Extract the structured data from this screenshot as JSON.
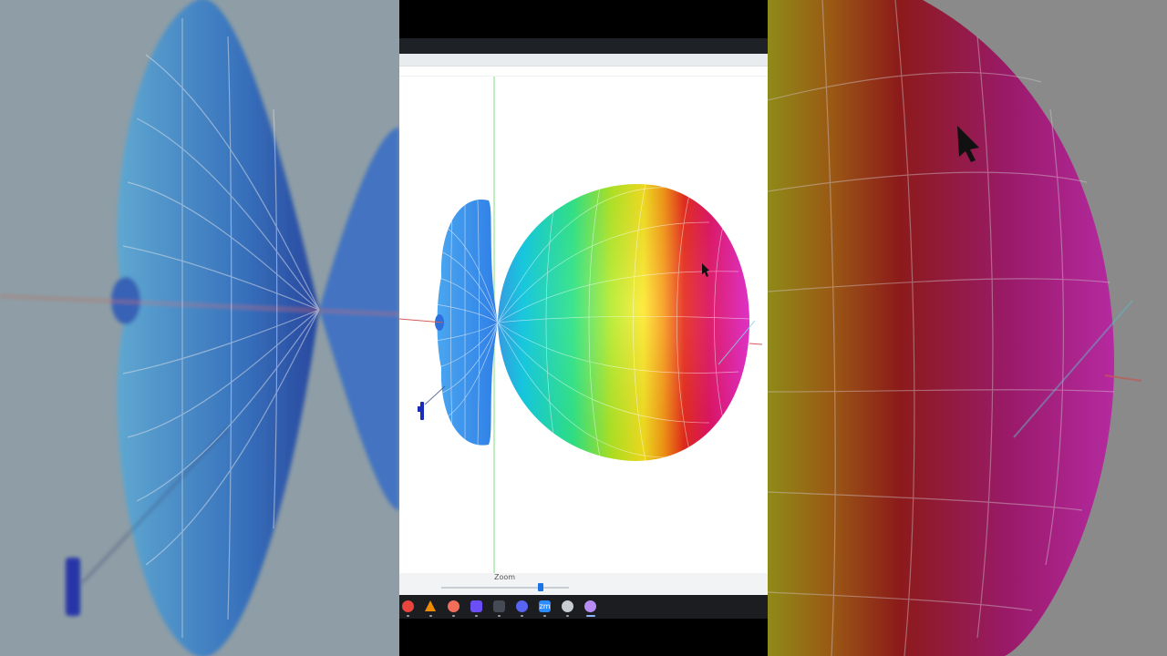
{
  "viewer": {
    "zoom_label": "Zoom",
    "zoom_level": 0.78
  },
  "taskbar": {
    "items": [
      {
        "icon": "chrome-icon",
        "color": "#e8453c"
      },
      {
        "icon": "vlc-icon",
        "color": "#f08a00"
      },
      {
        "icon": "app-launcher-icon",
        "color": "#f36d5b"
      },
      {
        "icon": "apps-grid-icon",
        "color": "#6b4ef5"
      },
      {
        "icon": "terminal-icon",
        "color": "#444b55"
      },
      {
        "icon": "discord-icon",
        "color": "#5865f2"
      },
      {
        "icon": "zoom-app-icon",
        "color": "#2d8cff",
        "text": "zm"
      },
      {
        "icon": "settings-gear-icon",
        "color": "#c7ccd2"
      },
      {
        "icon": "antenna-sim-icon",
        "color": "#b98cf5"
      }
    ]
  },
  "colors": {
    "taskbar_bg": "#1b1d21",
    "top_bar_bg": "#1e2226",
    "zoom_accent": "#1a73e8",
    "back_lobe": "#3d8ee8",
    "axis_green": "#6fdc6f",
    "axis_red": "#d45050"
  }
}
